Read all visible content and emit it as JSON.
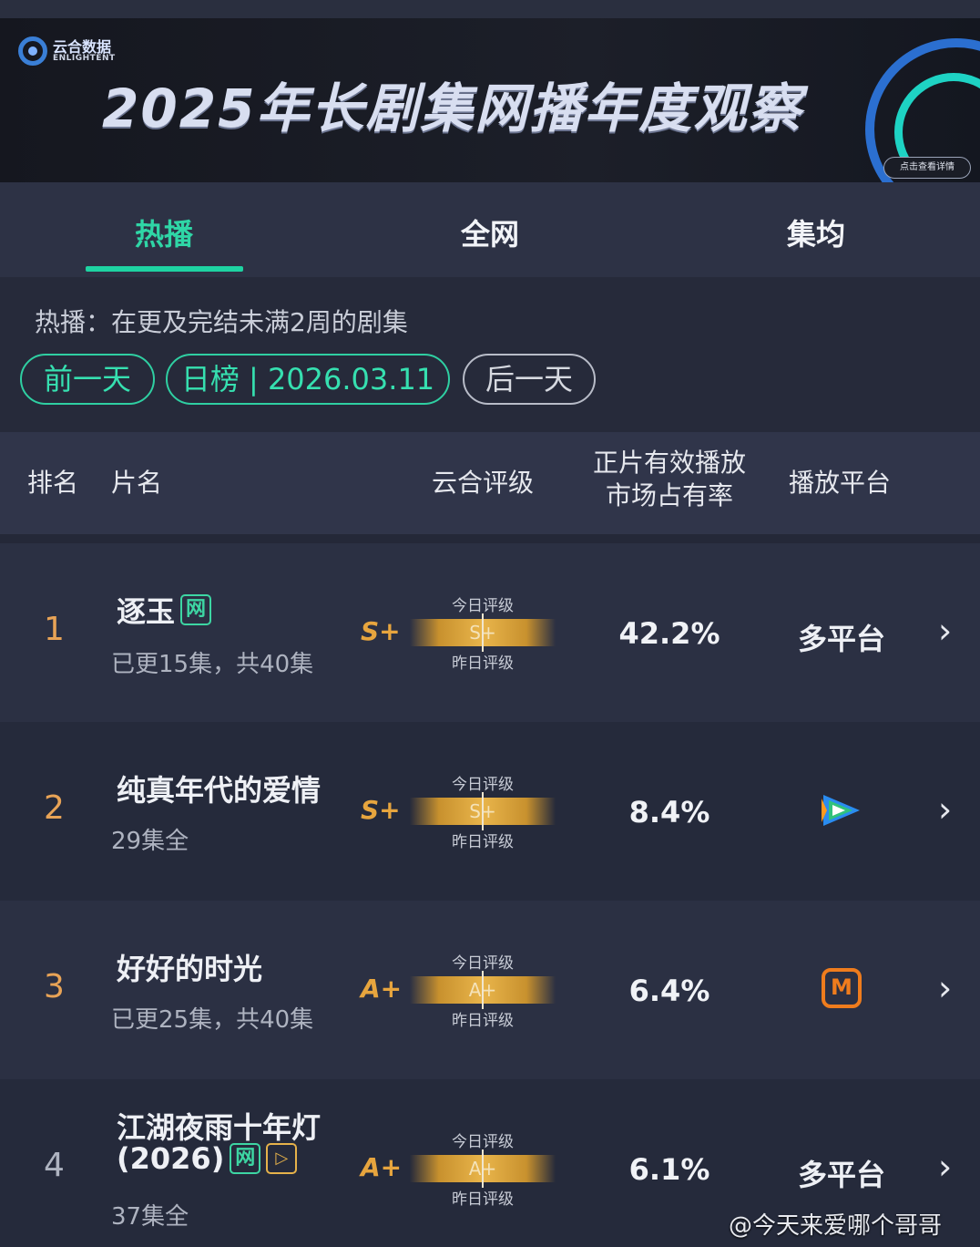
{
  "banner": {
    "logo_cn": "云合数据",
    "logo_en": "ENLIGHTENT",
    "title": "2025年长剧集网播年度观察",
    "detail_button": "点击查看详情"
  },
  "tabs": [
    {
      "label": "热播",
      "active": true
    },
    {
      "label": "全网",
      "active": false
    },
    {
      "label": "集均",
      "active": false
    }
  ],
  "filter": {
    "description": "热播：在更及完结未满2周的剧集",
    "prev_day": "前一天",
    "date_label": "日榜 | 2026.03.11",
    "next_day": "后一天"
  },
  "table": {
    "headers": {
      "rank": "排名",
      "name": "片名",
      "rating": "云合评级",
      "share_line1": "正片有效播放",
      "share_line2": "市场占有率",
      "platform": "播放平台"
    },
    "grade_today_label": "今日评级",
    "grade_yesterday_label": "昨日评级",
    "rows": [
      {
        "rank": "1",
        "title": "逐玉",
        "tags": [
          "网"
        ],
        "sub": "已更15集，共40集",
        "grade": "S+",
        "grade_bar": "S+",
        "share": "42.2%",
        "platform": "多平台",
        "platform_icon": "multi-platform"
      },
      {
        "rank": "2",
        "title": "纯真年代的爱情",
        "tags": [],
        "sub": "29集全",
        "grade": "S+",
        "grade_bar": "S+",
        "share": "8.4%",
        "platform": "",
        "platform_icon": "tencent-video-icon"
      },
      {
        "rank": "3",
        "title": "好好的时光",
        "tags": [],
        "sub": "已更25集，共40集",
        "grade": "A+",
        "grade_bar": "A+",
        "share": "6.4%",
        "platform": "",
        "platform_icon": "mango-tv-icon"
      },
      {
        "rank": "4",
        "title_line1": "江湖夜雨十年灯",
        "title_line2": "(2026)",
        "tags": [
          "网",
          "play"
        ],
        "sub": "37集全",
        "grade": "A+",
        "grade_bar": "A+",
        "share": "6.1%",
        "platform": "多平台",
        "platform_icon": "multi-platform"
      }
    ]
  },
  "watermark": "@今天来爱哪个哥哥",
  "colors": {
    "accent": "#1ed3a2",
    "grade": "#e7a53e",
    "rank": "#e8a356",
    "mango": "#ef7c1d"
  }
}
